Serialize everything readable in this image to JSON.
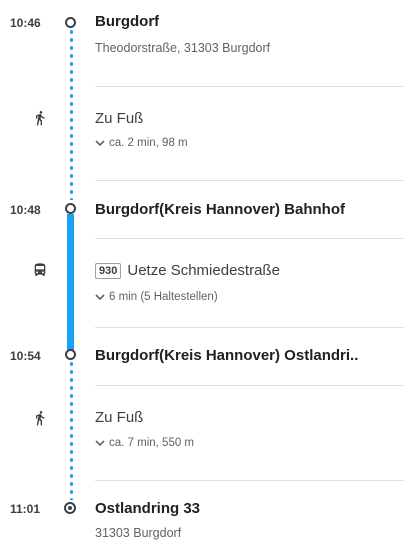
{
  "stops": [
    {
      "time": "10:46",
      "name": "Burgdorf",
      "sub": "Theodorstraße, 31303 Burgdorf"
    },
    {
      "time": "10:48",
      "name": "Burgdorf(Kreis Hannover) Bahnhof",
      "sub": ""
    },
    {
      "time": "10:54",
      "name": "Burgdorf(Kreis Hannover) Ostlandri..",
      "sub": ""
    },
    {
      "time": "11:01",
      "name": "Ostlandring 33",
      "sub": "31303 Burgdorf"
    }
  ],
  "segments": [
    {
      "mode": "walk",
      "icon": "walk-icon",
      "title": "Zu Fuß",
      "detail": "ca. 2 min, 98 m"
    },
    {
      "mode": "bus",
      "icon": "bus-icon",
      "line": "930",
      "title": "Uetze Schmiedestraße",
      "detail": "6 min (5 Haltestellen)"
    },
    {
      "mode": "walk",
      "icon": "walk-icon",
      "title": "Zu Fuß",
      "detail": "ca. 7 min, 550 m"
    }
  ],
  "colors": {
    "transit_line": "#1aa1f5",
    "walk_dots": "#1a9cf4",
    "text": "#202124",
    "muted": "#5f6368"
  }
}
